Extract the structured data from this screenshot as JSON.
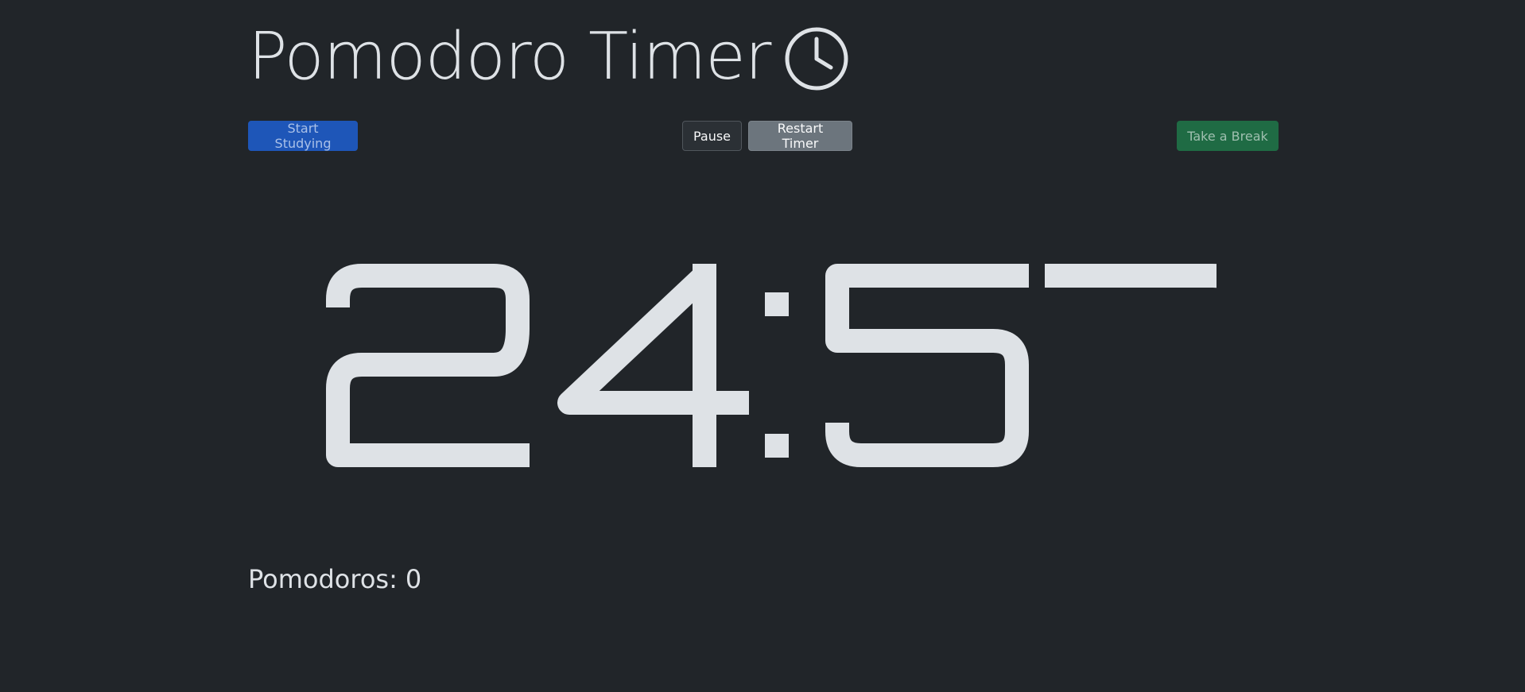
{
  "header": {
    "title": "Pomodoro Timer",
    "icon": "clock-icon"
  },
  "controls": {
    "start_label": "Start Studying",
    "pause_label": "Pause",
    "restart_label": "Restart Timer",
    "break_label": "Take a Break"
  },
  "timer": {
    "display": "24:57",
    "minutes": "24",
    "seconds": "57"
  },
  "stats": {
    "pomodoros_label": "Pomodoros:",
    "pomodoros_count": "0"
  },
  "colors": {
    "background": "#212529",
    "text": "#dee2e6",
    "primary": "#1e56b8",
    "secondary": "#6c757d",
    "success": "#1f6b44"
  }
}
